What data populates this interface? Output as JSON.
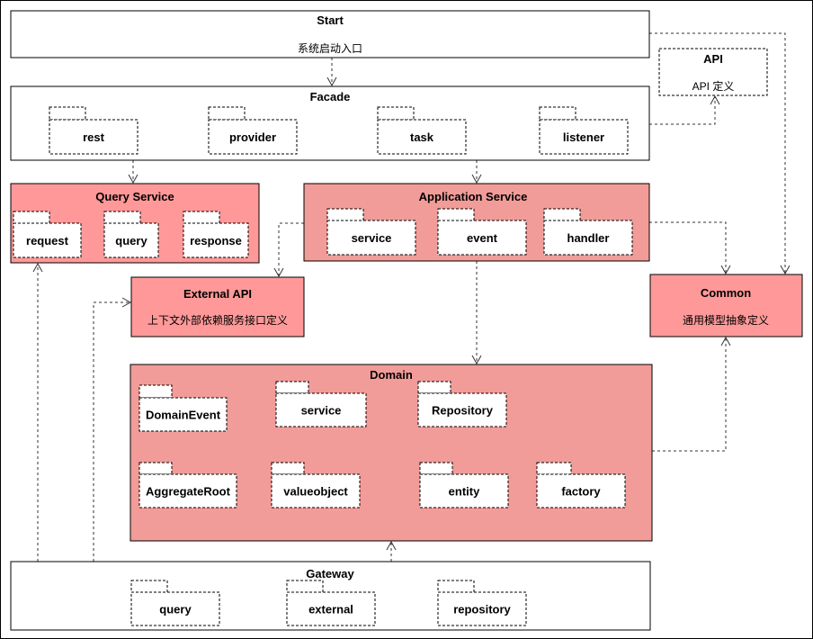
{
  "colors": {
    "query_service": "#FF9999",
    "application_service": "#F19C99",
    "external_api": "#FF9999",
    "common": "#FF9999",
    "domain": "#F19C99"
  },
  "start": {
    "title": "Start",
    "subtitle": "系统启动入口"
  },
  "api": {
    "title": "API",
    "subtitle": "API 定义"
  },
  "facade": {
    "title": "Facade",
    "packages": [
      "rest",
      "provider",
      "task",
      "listener"
    ]
  },
  "query_service": {
    "title": "Query  Service",
    "packages": [
      "request",
      "query",
      "response"
    ]
  },
  "application_service": {
    "title": "Application Service",
    "packages": [
      "service",
      "event",
      "handler"
    ]
  },
  "external_api": {
    "title": "External API",
    "subtitle": "上下文外部依赖服务接口定义"
  },
  "common": {
    "title": "Common",
    "subtitle": "通用模型抽象定义"
  },
  "domain": {
    "title": "Domain",
    "packages": [
      "DomainEvent",
      "service",
      "Repository",
      "AggregateRoot",
      "valueobject",
      "entity",
      "factory"
    ]
  },
  "gateway": {
    "title": "Gateway",
    "packages": [
      "query",
      "external",
      "repository"
    ]
  }
}
